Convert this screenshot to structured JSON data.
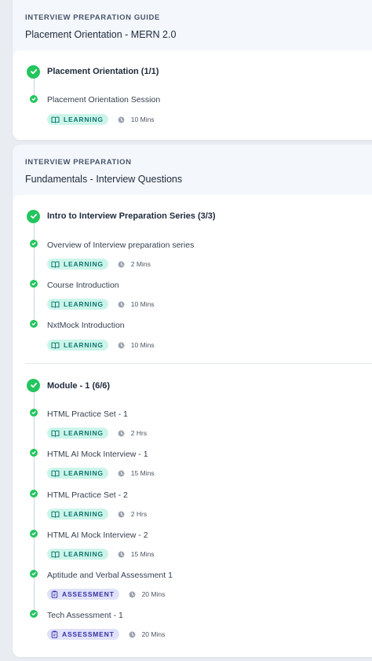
{
  "sections": [
    {
      "overline": "INTERVIEW PREPARATION GUIDE",
      "title": "Placement Orientation - MERN 2.0",
      "groups": [
        {
          "title": "Placement Orientation (1/1)",
          "items": [
            {
              "title": "Placement Orientation Session",
              "tag": "LEARNING",
              "duration": "10 Mins"
            }
          ]
        }
      ]
    },
    {
      "overline": "INTERVIEW PREPARATION",
      "title": "Fundamentals - Interview Questions",
      "groups": [
        {
          "title": "Intro to Interview Preparation Series (3/3)",
          "items": [
            {
              "title": "Overview of Interview preparation series",
              "tag": "LEARNING",
              "duration": "2 Mins"
            },
            {
              "title": "Course Introduction",
              "tag": "LEARNING",
              "duration": "10 Mins"
            },
            {
              "title": "NxtMock Introduction",
              "tag": "LEARNING",
              "duration": "10 Mins"
            }
          ]
        },
        {
          "title": "Module - 1 (6/6)",
          "items": [
            {
              "title": "HTML Practice Set - 1",
              "tag": "LEARNING",
              "duration": "2 Hrs"
            },
            {
              "title": "HTML AI Mock Interview - 1",
              "tag": "LEARNING",
              "duration": "15 Mins"
            },
            {
              "title": "HTML Practice Set - 2",
              "tag": "LEARNING",
              "duration": "2 Hrs"
            },
            {
              "title": "HTML AI Mock Interview - 2",
              "tag": "LEARNING",
              "duration": "15 Mins"
            },
            {
              "title": "Aptitude and Verbal Assessment 1",
              "tag": "ASSESSMENT",
              "duration": "20 Mins"
            },
            {
              "title": "Tech Assessment - 1",
              "tag": "ASSESSMENT",
              "duration": "20 Mins"
            }
          ]
        }
      ]
    }
  ],
  "icons": {
    "completed": "check-circle-icon",
    "learning": "book-open-icon",
    "assessment": "clipboard-icon",
    "duration": "clock-icon"
  },
  "colors": {
    "completed": "#22c55e",
    "learning_bg": "#ccf5ea",
    "learning_text": "#0f766e",
    "assessment_bg": "#e0e2fb",
    "assessment_text": "#3730a3"
  }
}
